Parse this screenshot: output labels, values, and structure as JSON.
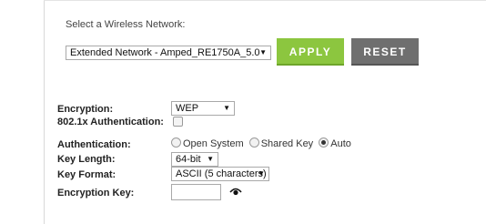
{
  "network": {
    "select_label": "Select a Wireless Network:",
    "selected": "Extended Network - Amped_RE1750A_5.0",
    "apply_label": "APPLY",
    "reset_label": "RESET"
  },
  "form": {
    "encryption_label": "Encryption:",
    "encryption_value": "WEP",
    "dot1x_label": "802.1x Authentication:",
    "dot1x_checked": false,
    "authentication_label": "Authentication:",
    "auth_options": [
      "Open System",
      "Shared Key",
      "Auto"
    ],
    "auth_selected": "Auto",
    "key_length_label": "Key Length:",
    "key_length_value": "64-bit",
    "key_format_label": "Key Format:",
    "key_format_value": "ASCII (5 characters)",
    "encryption_key_label": "Encryption Key:",
    "encryption_key_value": ""
  },
  "colors": {
    "apply": "#8cc63f",
    "reset": "#6f6f6f"
  },
  "icons": {
    "show_password": "eye-icon"
  }
}
